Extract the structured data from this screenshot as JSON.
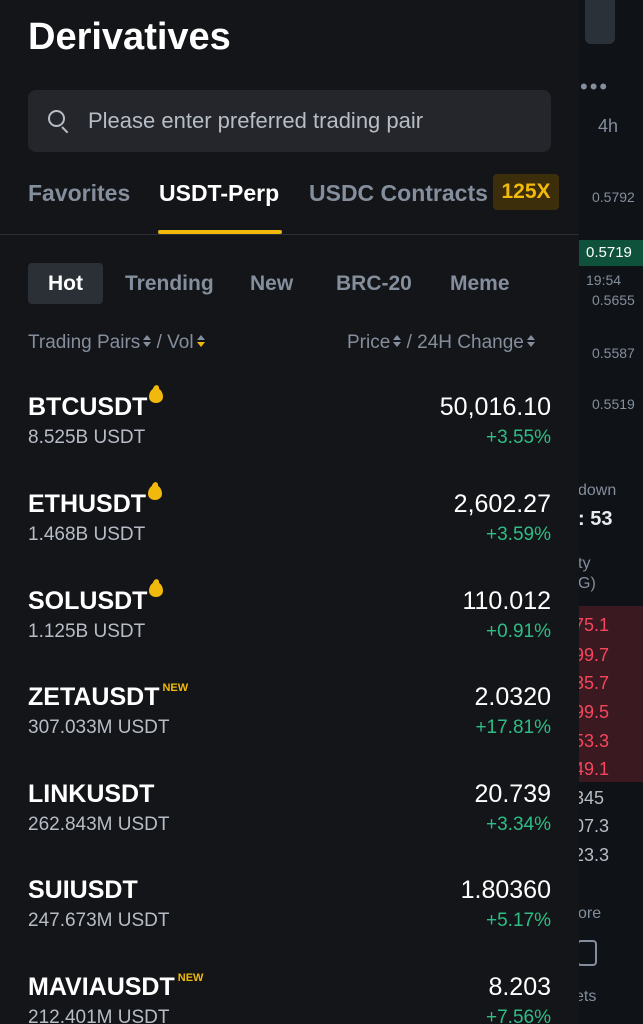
{
  "header": {
    "title": "Derivatives"
  },
  "search": {
    "placeholder": "Please enter preferred trading pair"
  },
  "tabs": [
    {
      "label": "Favorites"
    },
    {
      "label": "USDT-Perp"
    },
    {
      "label": "USDC Contracts"
    }
  ],
  "tab_badge": "125X",
  "chips": [
    {
      "label": "Hot"
    },
    {
      "label": "Trending"
    },
    {
      "label": "New"
    },
    {
      "label": "BRC-20"
    },
    {
      "label": "Meme"
    }
  ],
  "columns": {
    "pairs": "Trading Pairs",
    "sep1": "/",
    "vol": "Vol",
    "price": "Price",
    "sep2": "/",
    "change": "24H Change"
  },
  "rows": [
    {
      "pair": "BTCUSDT",
      "vol": "8.525B USDT",
      "price": "50,016.10",
      "change": "+3.55%",
      "tag": "hot"
    },
    {
      "pair": "ETHUSDT",
      "vol": "1.468B USDT",
      "price": "2,602.27",
      "change": "+3.59%",
      "tag": "hot"
    },
    {
      "pair": "SOLUSDT",
      "vol": "1.125B USDT",
      "price": "110.012",
      "change": "+0.91%",
      "tag": "hot"
    },
    {
      "pair": "ZETAUSDT",
      "vol": "307.033M USDT",
      "price": "2.0320",
      "change": "+17.81%",
      "tag": "NEW"
    },
    {
      "pair": "LINKUSDT",
      "vol": "262.843M USDT",
      "price": "20.739",
      "change": "+3.34%",
      "tag": ""
    },
    {
      "pair": "SUIUSDT",
      "vol": "247.673M USDT",
      "price": "1.80360",
      "change": "+5.17%",
      "tag": ""
    },
    {
      "pair": "MAVIAUSDT",
      "vol": "212.401M USDT",
      "price": "8.203",
      "change": "+7.56%",
      "tag": "NEW"
    }
  ],
  "background": {
    "interval": "4h",
    "axis_prices": [
      "0.5792",
      "0.5655",
      "0.5587",
      "0.5519"
    ],
    "last_price": "0.5719",
    "countdown": "19:54",
    "label_down": "down",
    "timer": ": 53",
    "label_ty": "ty",
    "label_g": "G)",
    "orderbook_red": [
      "75.1",
      "99.7",
      "35.7",
      "99.5",
      "53.3",
      "49.1"
    ],
    "orderbook_white": [
      "345",
      "07.3",
      "23.3"
    ],
    "more": "ore",
    "nav_label": "ets"
  },
  "colors": {
    "accent": "#f0b90b",
    "up": "#2ebd85",
    "down": "#f6465d",
    "panel": "#141519"
  }
}
